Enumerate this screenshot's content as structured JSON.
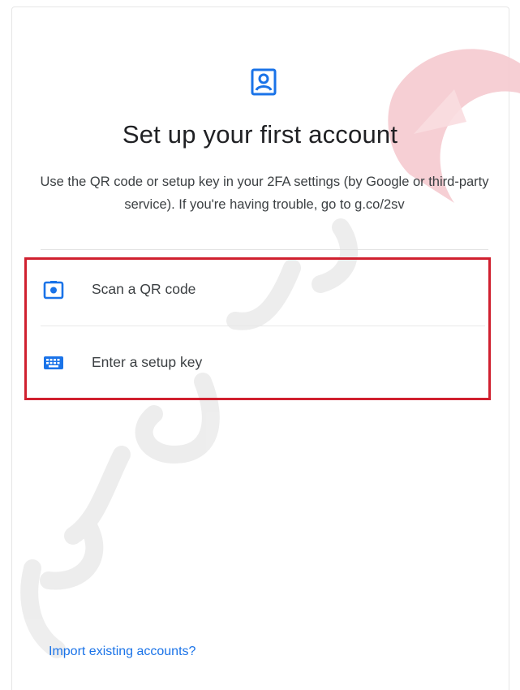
{
  "header": {
    "icon": "account-box-icon",
    "title": "Set up your first account",
    "description": "Use the QR code or setup key in your 2FA settings (by Google or third-party service). If you're having trouble, go to g.co/2sv"
  },
  "options": [
    {
      "icon": "camera-icon",
      "label": "Scan a QR code"
    },
    {
      "icon": "keyboard-icon",
      "label": "Enter a setup key"
    }
  ],
  "footer": {
    "import_label": "Import existing accounts?"
  },
  "colors": {
    "accent_blue": "#1a73e8",
    "highlight_red": "#d0202f",
    "watermark_pink": "#f4c7cc"
  }
}
